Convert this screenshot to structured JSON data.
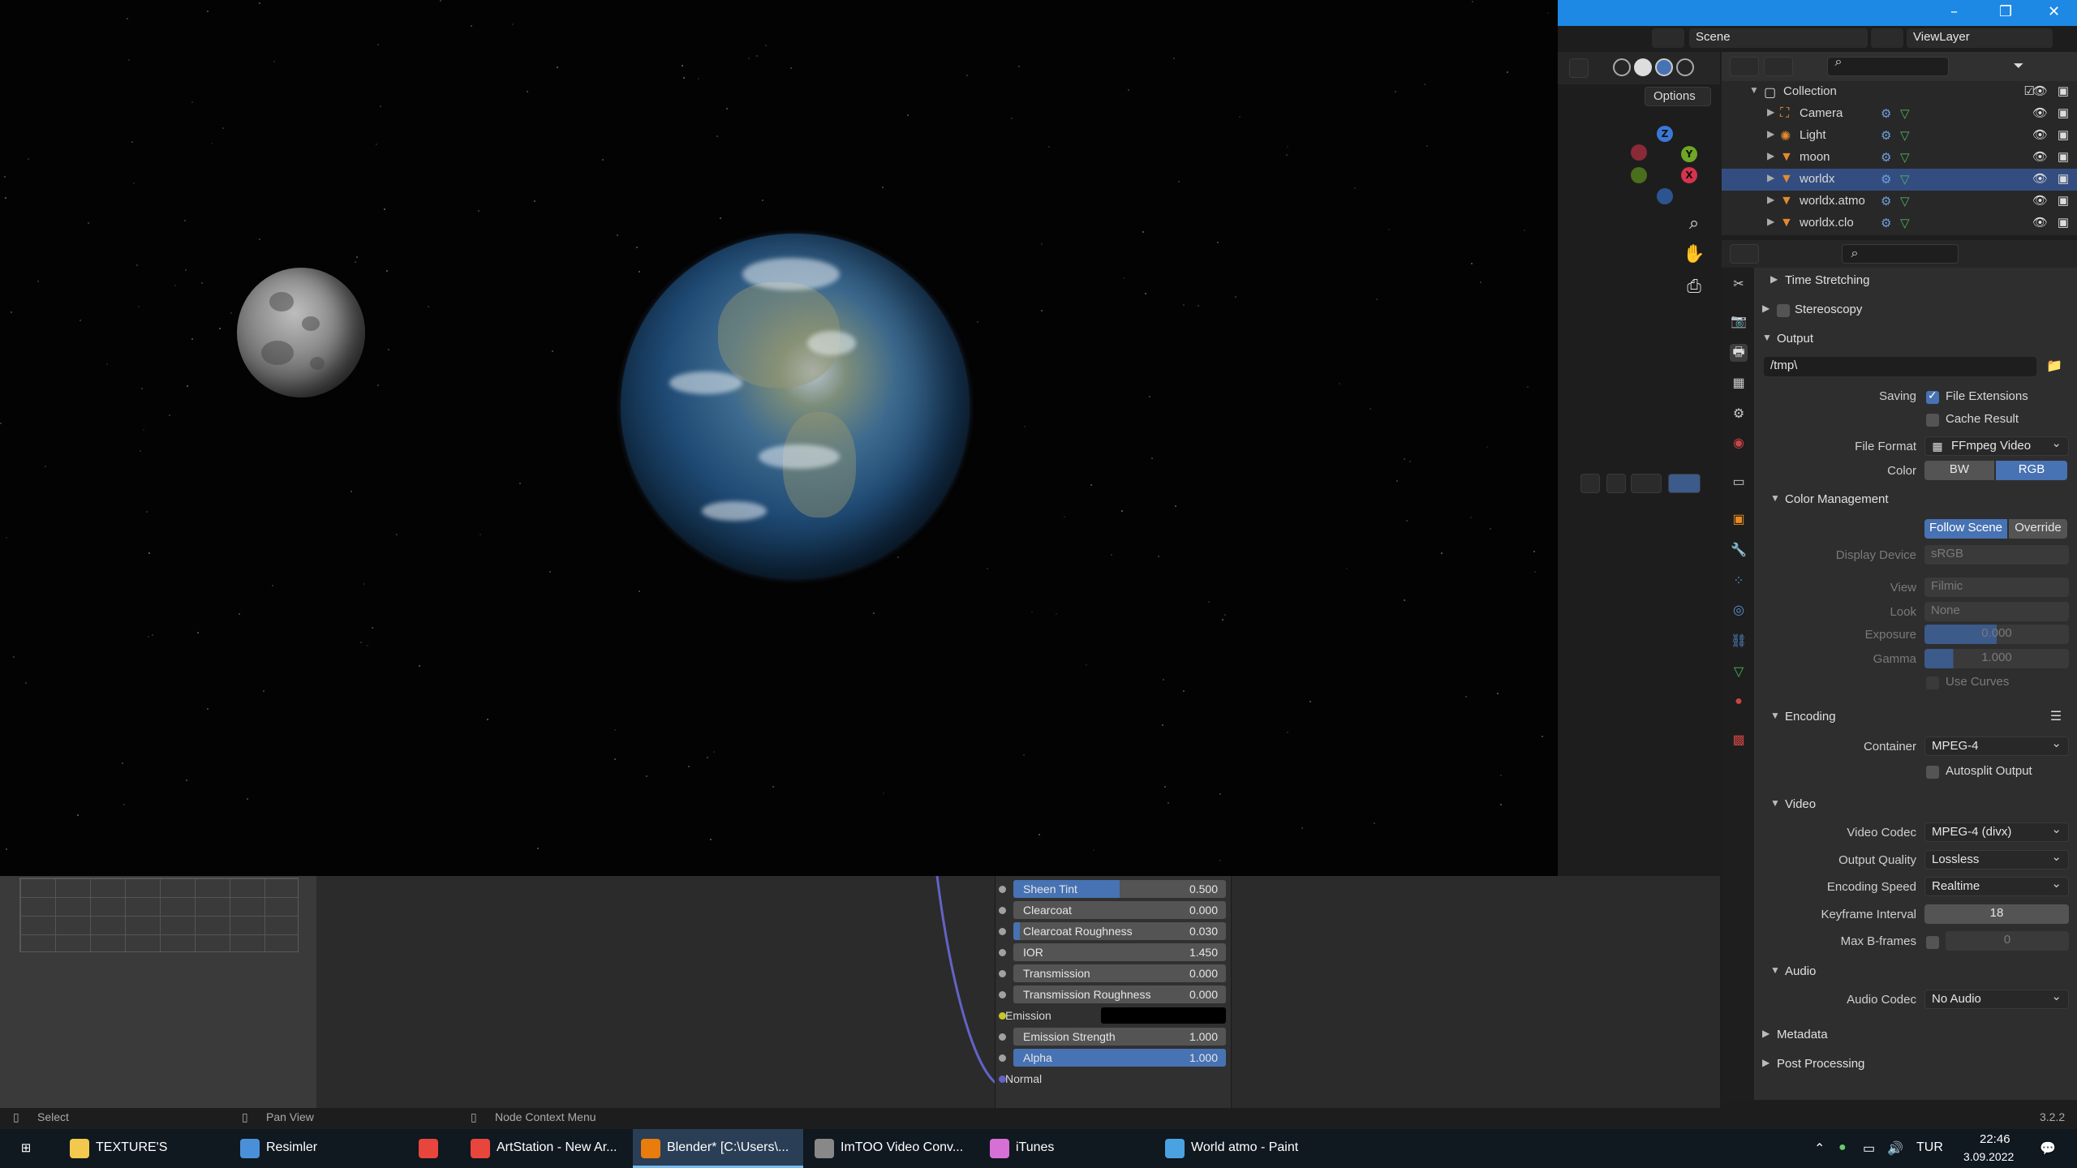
{
  "window": {
    "minimize_icon": "minimize-icon",
    "maximize_icon": "maximize-icon",
    "close_icon": "close-icon",
    "accent": "#1e88e5"
  },
  "header": {
    "scene": "Scene",
    "view_layer": "ViewLayer"
  },
  "viewport": {
    "options_label": "Options"
  },
  "outliner": {
    "collection": "Collection",
    "items": [
      {
        "label": "Camera"
      },
      {
        "label": "Light"
      },
      {
        "label": "moon"
      },
      {
        "label": "worldx"
      },
      {
        "label": "worldx.atmo"
      },
      {
        "label": "worldx.clo"
      }
    ],
    "selected": "worldx",
    "selection_color": "#334d80"
  },
  "properties": {
    "sections": {
      "time_stretching": "Time Stretching",
      "stereoscopy": "Stereoscopy",
      "output": "Output",
      "color_management": "Color Management",
      "encoding": "Encoding",
      "video": "Video",
      "audio": "Audio",
      "metadata": "Metadata",
      "post_processing": "Post Processing"
    },
    "output_path": "/tmp\\",
    "saving_label": "Saving",
    "file_extensions": "File Extensions",
    "cache_result": "Cache Result",
    "file_format_label": "File Format",
    "file_format": "FFmpeg Video",
    "color_label": "Color",
    "color_bw": "BW",
    "color_rgb": "RGB",
    "follow_scene": "Follow Scene",
    "override": "Override",
    "display_device_label": "Display Device",
    "display_device": "sRGB",
    "view_label": "View",
    "view": "Filmic",
    "look_label": "Look",
    "look": "None",
    "exposure_label": "Exposure",
    "exposure": "0.000",
    "gamma_label": "Gamma",
    "gamma": "1.000",
    "use_curves": "Use Curves",
    "container_label": "Container",
    "container": "MPEG-4",
    "autosplit": "Autosplit Output",
    "video_codec_label": "Video Codec",
    "video_codec": "MPEG-4 (divx)",
    "output_quality_label": "Output Quality",
    "output_quality": "Lossless",
    "encoding_speed_label": "Encoding Speed",
    "encoding_speed": "Realtime",
    "keyframe_interval_label": "Keyframe Interval",
    "keyframe_interval": "18",
    "max_bframes_label": "Max B-frames",
    "max_bframes": "0",
    "audio_codec_label": "Audio Codec",
    "audio_codec": "No Audio",
    "version": "3.2.2"
  },
  "node": {
    "rows": [
      {
        "name": "Sheen Tint",
        "value": "0.500",
        "fill": 0.5
      },
      {
        "name": "Clearcoat",
        "value": "0.000",
        "fill": 0
      },
      {
        "name": "Clearcoat Roughness",
        "value": "0.030",
        "fill": 0.03
      },
      {
        "name": "IOR",
        "value": "1.450",
        "fill": 0
      },
      {
        "name": "Transmission",
        "value": "0.000",
        "fill": 0
      },
      {
        "name": "Transmission Roughness",
        "value": "0.000",
        "fill": 0
      }
    ],
    "emission": "Emission",
    "emission_strength": {
      "name": "Emission Strength",
      "value": "1.000"
    },
    "alpha": {
      "name": "Alpha",
      "value": "1.000",
      "fill": 1
    },
    "normal": "Normal"
  },
  "statusbar": {
    "select": "Select",
    "pan_view": "Pan View",
    "node_context_menu": "Node Context Menu"
  },
  "taskbar": {
    "items": [
      {
        "label": "TEXTURE'S",
        "icon": "folder-icon"
      },
      {
        "label": "Resimler",
        "icon": "photos-icon"
      },
      {
        "label": "",
        "icon": "chrome-icon"
      },
      {
        "label": "ArtStation - New Ar...",
        "icon": "chrome-icon"
      },
      {
        "label": "Blender* [C:\\Users\\...",
        "icon": "blender-icon"
      },
      {
        "label": "ImTOO Video Conv...",
        "icon": "video-converter-icon"
      },
      {
        "label": "iTunes",
        "icon": "itunes-icon"
      },
      {
        "label": "World atmo - Paint",
        "icon": "paint-icon"
      }
    ],
    "lang": "TUR",
    "time": "22:46",
    "date": "3.09.2022"
  }
}
